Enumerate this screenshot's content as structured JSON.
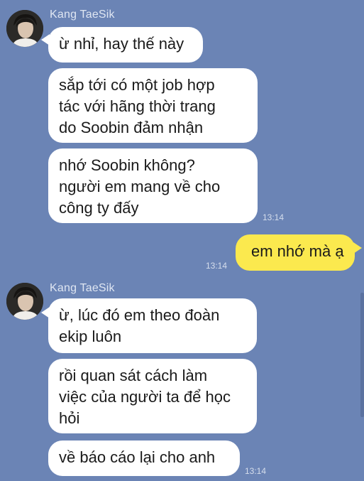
{
  "colors": {
    "background": "#6b84b5",
    "incoming_bubble": "#ffffff",
    "outgoing_bubble": "#fbe94e"
  },
  "contact": {
    "name": "Kang TaeSik",
    "avatar_icon": "profile-photo"
  },
  "messages": [
    {
      "text": "ừ nhỉ, hay thế này"
    },
    {
      "text": "sắp tới có một job hợp\ntác với hãng thời trang\ndo Soobin đảm nhận"
    },
    {
      "text": "nhớ Soobin không?\nngười em mang về cho\ncông ty đấy",
      "time": "13:14"
    },
    {
      "text": "em nhớ mà ạ",
      "time": "13:14"
    },
    {
      "text": "ừ, lúc đó em theo đoàn\nekip luôn"
    },
    {
      "text": "rồi quan sát cách làm\nviệc của người ta để học\nhỏi"
    },
    {
      "text": "về báo cáo lại cho anh",
      "time": "13:14"
    }
  ]
}
